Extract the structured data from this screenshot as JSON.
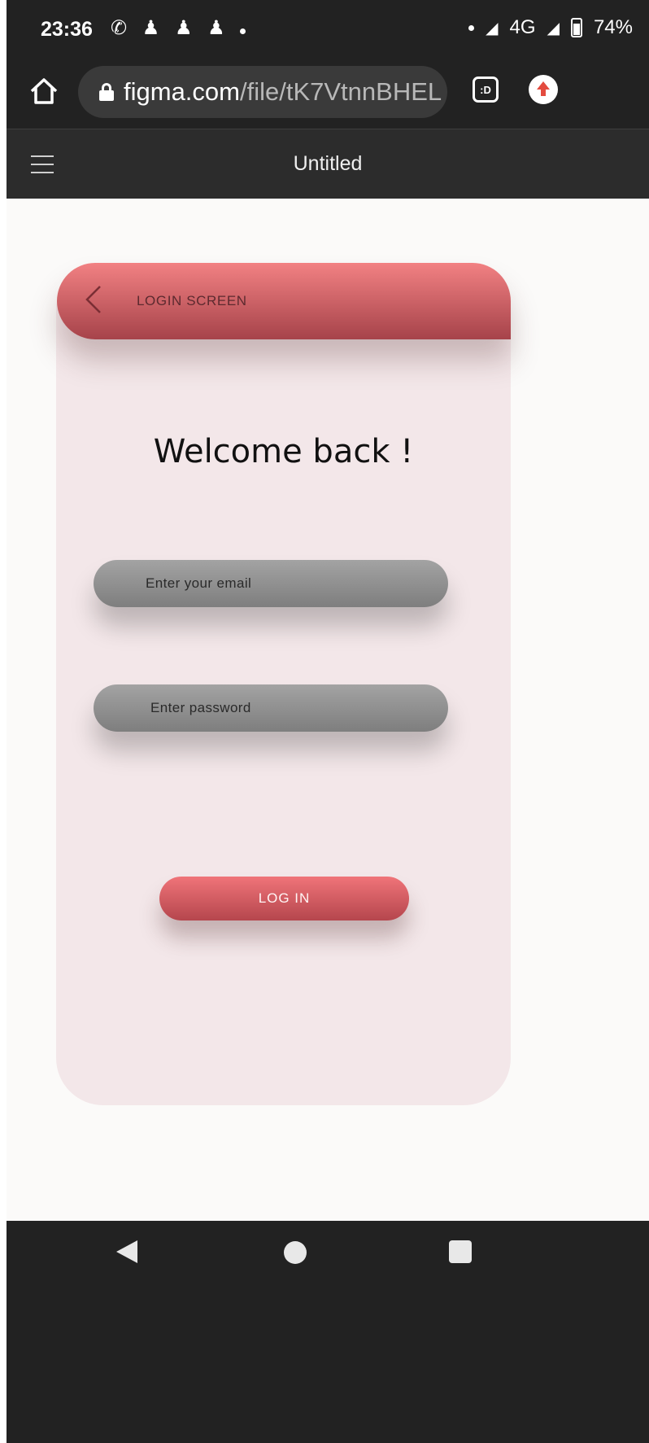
{
  "status_bar": {
    "time": "23:36",
    "notification_icons": [
      "whatsapp-icon",
      "snapchat-icon",
      "snapchat-icon",
      "snapchat-icon",
      "dot"
    ],
    "network": "4G",
    "battery": "74%"
  },
  "browser": {
    "url_host": "figma.com",
    "url_path": "/file/tK7VtnnBHEL",
    "tab_icon_label": ":D"
  },
  "figma": {
    "file_title": "Untitled"
  },
  "login": {
    "header_label": "LOGIN SCREEN",
    "welcome": "Welcome back !",
    "email_placeholder": "Enter your email",
    "password_placeholder": "Enter password",
    "login_button": "LOG IN"
  },
  "colors": {
    "header_top": "#f28183",
    "header_bottom": "#a6434a",
    "card_bg": "#f3e7e9",
    "field": "#8f8f8f",
    "button": "#e0636a",
    "chrome_dark": "#222222"
  }
}
